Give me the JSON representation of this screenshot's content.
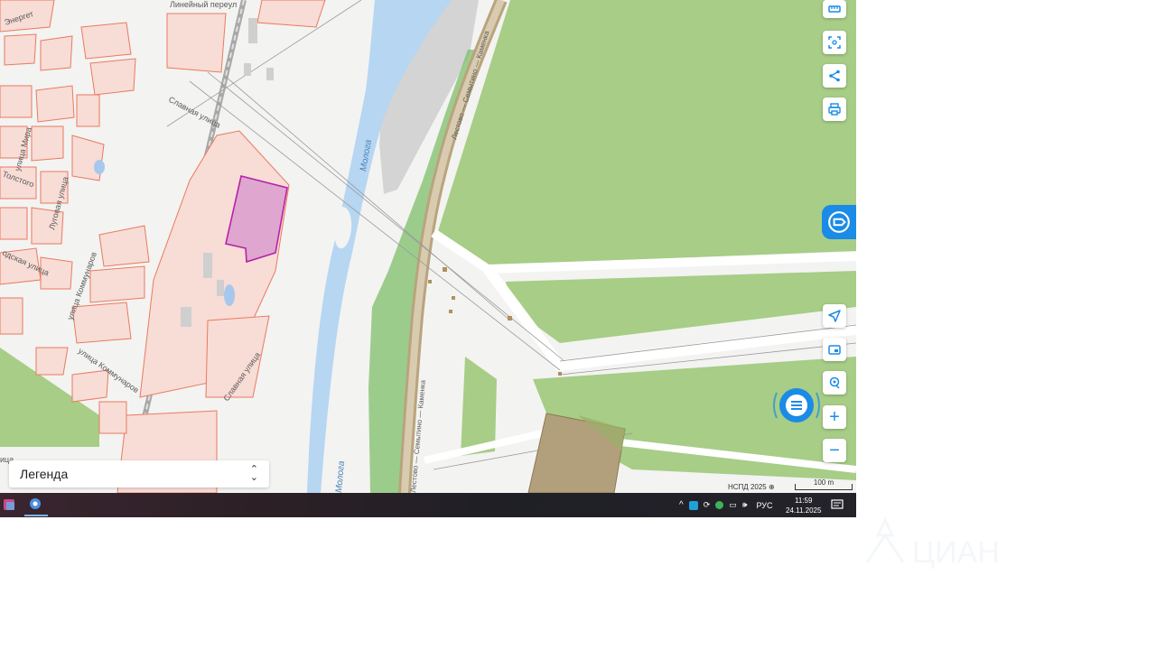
{
  "map": {
    "labels": {
      "energy_street": "Энергет",
      "lineynyi": "Линейный переул",
      "slavnaya": "Славная улица",
      "slavnaya2": "Славная улица",
      "mira": "улица Мира",
      "lugovaya": "Луговая улица",
      "tolstogo": "Толстого",
      "zavodskaya": "одская улица",
      "kommunarov": "улица Коммунаров",
      "kommunarov2": "улица Коммунаров",
      "mologa": "Молога",
      "mologa2": "Молога",
      "road_top": "Лестово — Семытино — Каменка",
      "road_bottom": "Лестово — Семытино — Каменка",
      "street_bottom_left": "ица"
    },
    "colors": {
      "water": "#b6d6f2",
      "park": "#a5cb85",
      "parcel_fill": "#f8dcd6",
      "parcel_border": "#ea7a5e",
      "highlight": "#b522a8",
      "accent": "#1a8be6"
    }
  },
  "toolbar": {
    "buttons": [
      {
        "icon": "ruler-icon"
      },
      {
        "icon": "area-select-icon"
      },
      {
        "icon": "share-icon"
      },
      {
        "icon": "print-icon"
      }
    ],
    "lower_buttons": [
      {
        "icon": "navigate-icon"
      },
      {
        "icon": "layers-icon"
      },
      {
        "icon": "locate-icon"
      }
    ],
    "zoom_in": "+",
    "zoom_out": "−"
  },
  "legend": {
    "label": "Легенда"
  },
  "attribution": {
    "source": "НСПД 2025 ⊕",
    "scale": "100 m"
  },
  "taskbar": {
    "language": "РУС",
    "time": "11:59",
    "date": "24.11.2025"
  },
  "watermark": {
    "text": "ЦИАН"
  }
}
